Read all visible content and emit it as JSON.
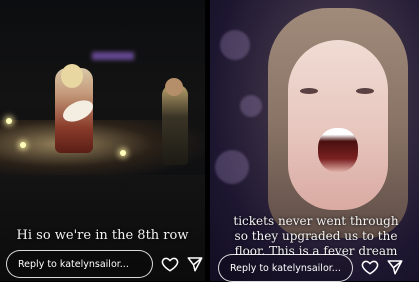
{
  "left_story": {
    "caption": "Hi so we're in the 8th row",
    "reply_placeholder": "Reply to katelynsailor...",
    "like_icon": "heart-icon",
    "share_icon": "send-icon"
  },
  "right_story": {
    "caption_lines": [
      "tickets never went through",
      "so they upgraded us to the",
      "floor. This is a fever dream"
    ],
    "reply_placeholder": "Reply to katelynsailor...",
    "like_icon": "heart-icon",
    "share_icon": "send-icon"
  },
  "colors": {
    "text": "#ffffff",
    "background": "#000000"
  }
}
